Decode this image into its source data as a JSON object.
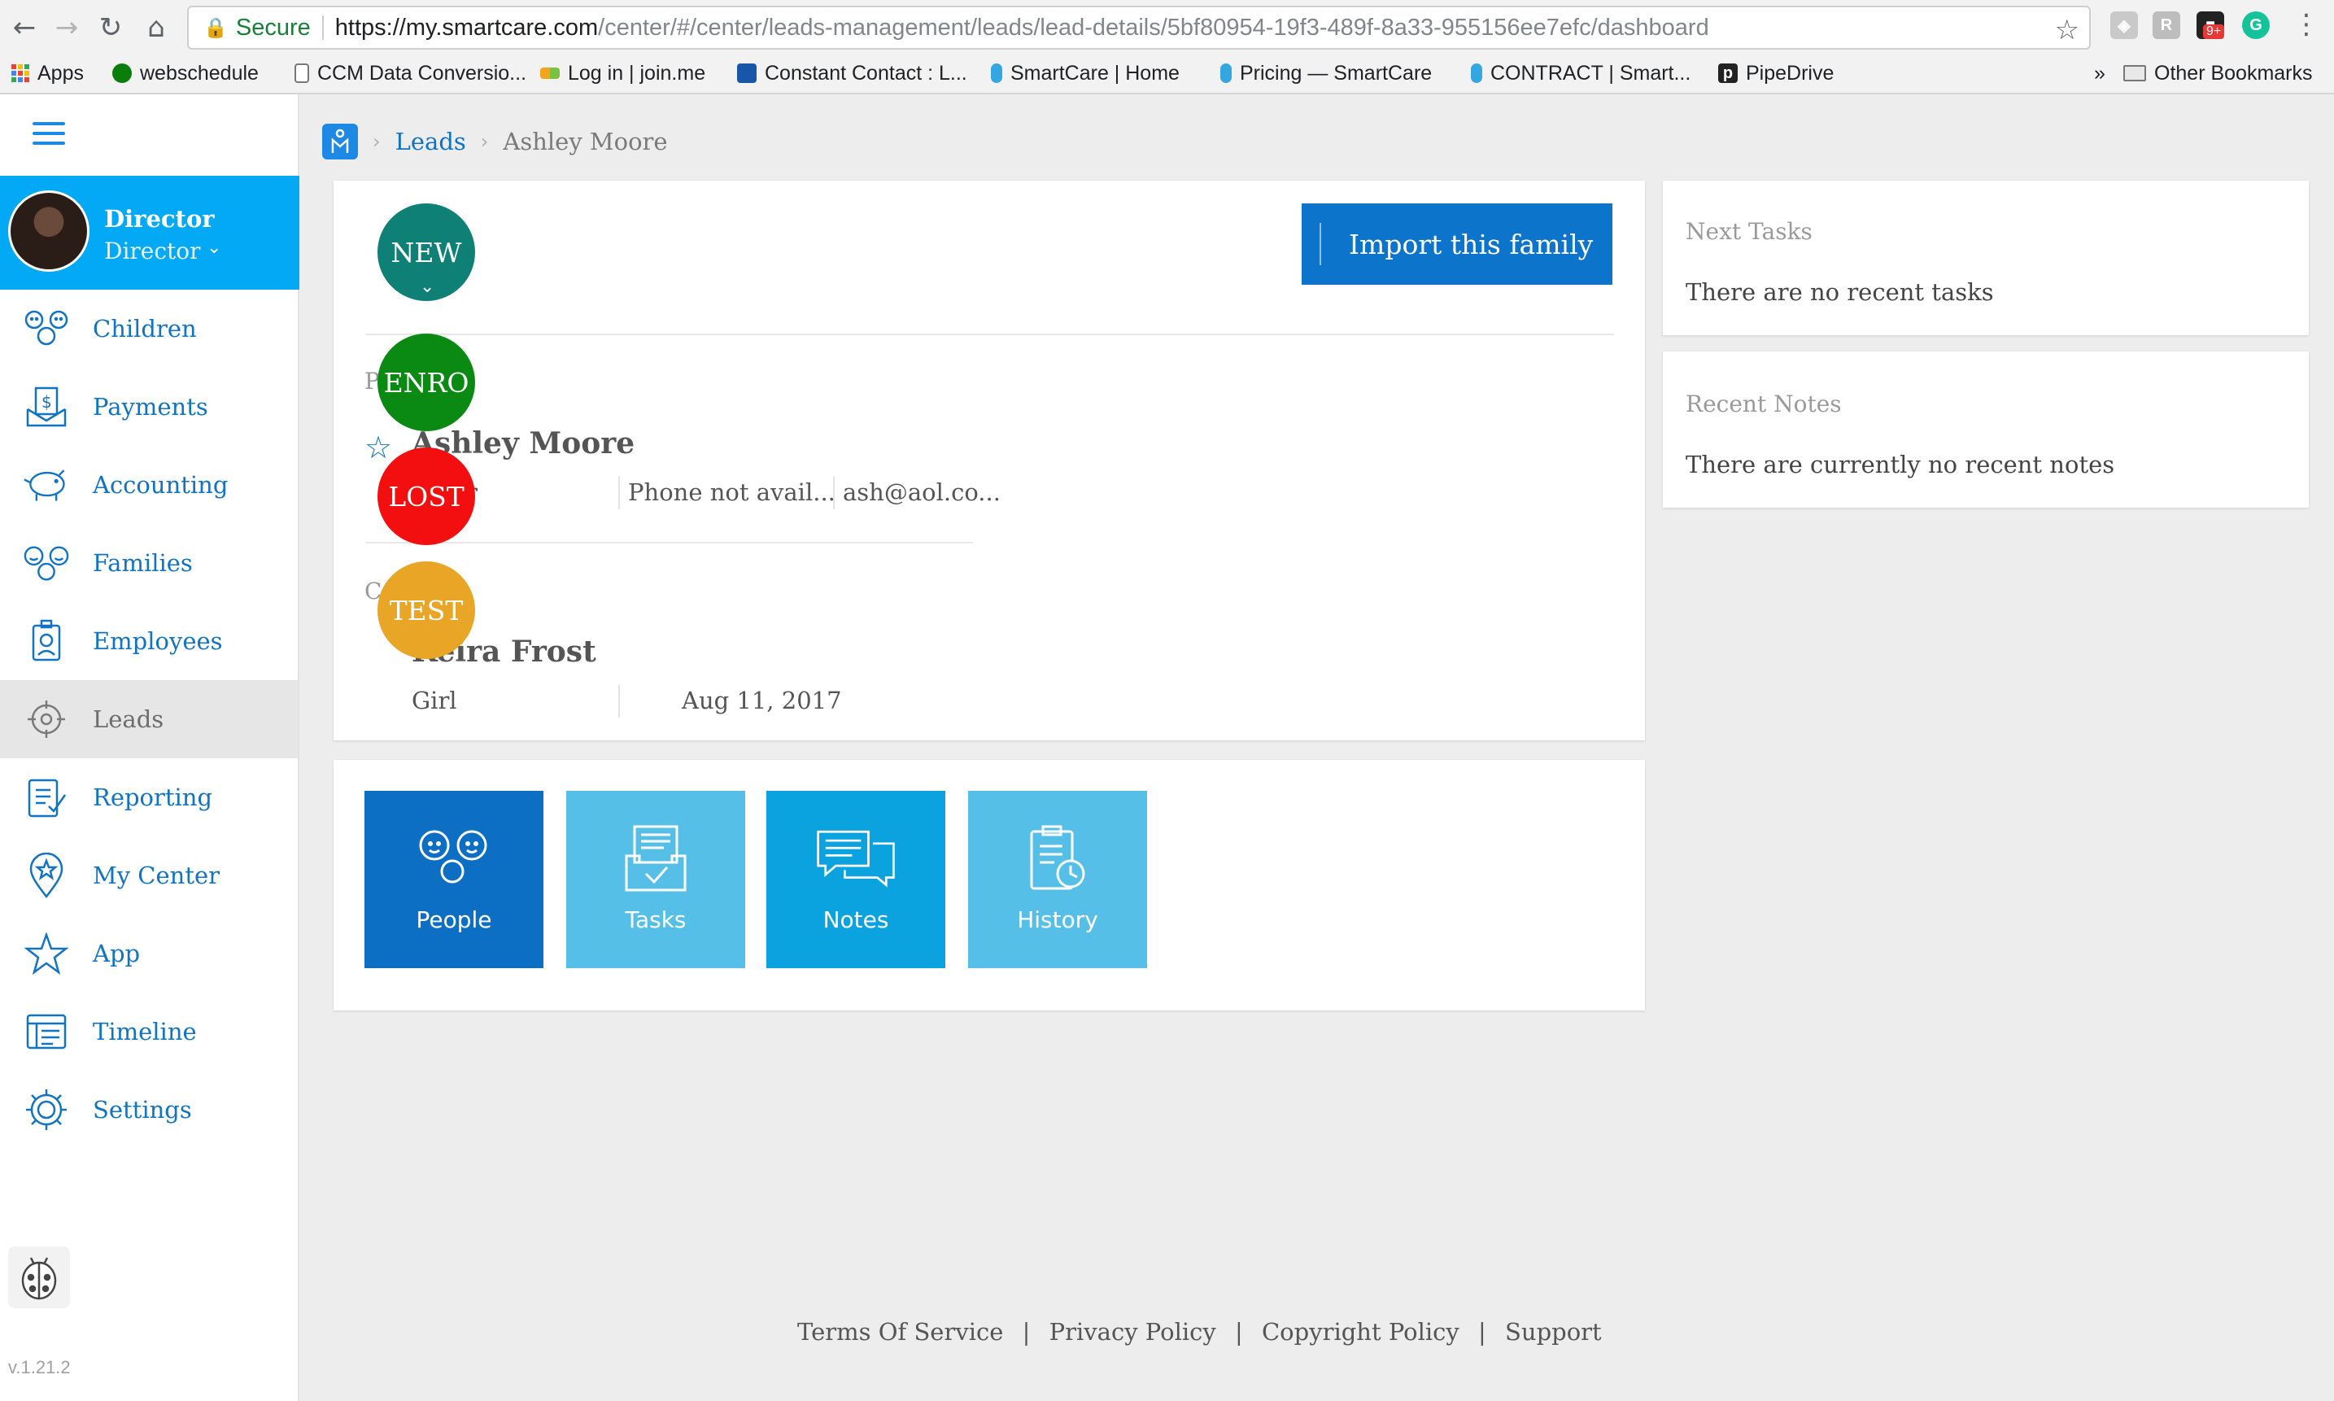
{
  "browser": {
    "secure_label": "Secure",
    "url_host": "https://my.smartcare.com",
    "url_path": "/center/#/center/leads-management/leads/lead-details/5bf80954-19f3-489f-8a33-955156ee7efc/dashboard",
    "extension_badge": "9+",
    "bookmarks": [
      {
        "label": "Apps"
      },
      {
        "label": "webschedule"
      },
      {
        "label": "CCM Data Conversio..."
      },
      {
        "label": "Log in | join.me"
      },
      {
        "label": "Constant Contact : L..."
      },
      {
        "label": "SmartCare | Home"
      },
      {
        "label": "Pricing — SmartCare"
      },
      {
        "label": "CONTRACT | Smart..."
      },
      {
        "label": "PipeDrive"
      }
    ],
    "overflow_label": "»",
    "other_bookmarks": "Other Bookmarks"
  },
  "sidebar": {
    "profile_name": "Director",
    "profile_role": "Director",
    "items": [
      {
        "label": "Children",
        "icon": "children-icon"
      },
      {
        "label": "Payments",
        "icon": "payments-icon"
      },
      {
        "label": "Accounting",
        "icon": "piggy-bank-icon"
      },
      {
        "label": "Families",
        "icon": "families-icon"
      },
      {
        "label": "Employees",
        "icon": "employee-badge-icon"
      },
      {
        "label": "Leads",
        "icon": "target-icon",
        "active": true
      },
      {
        "label": "Reporting",
        "icon": "reporting-icon"
      },
      {
        "label": "My Center",
        "icon": "location-star-icon"
      },
      {
        "label": "App",
        "icon": "star-icon"
      },
      {
        "label": "Timeline",
        "icon": "timeline-icon"
      },
      {
        "label": "Settings",
        "icon": "gear-icon"
      }
    ],
    "version": "v.1.21.2"
  },
  "breadcrumb": {
    "leads": "Leads",
    "current": "Ashley Moore"
  },
  "lead": {
    "import_button": "Import this family",
    "statuses": [
      {
        "label": "NEW",
        "color": "#0e8075"
      },
      {
        "label": "ENRO",
        "color": "#0a8a12"
      },
      {
        "label": "LOST",
        "color": "#f30f0f"
      },
      {
        "label": "TEST",
        "color": "#e8a526"
      }
    ],
    "parent_section_fragment": "P",
    "parent_name": "Ashley Moore",
    "parent_role_fragment": "er",
    "parent_phone": "Phone not avail...",
    "parent_email": "ash@aol.co...",
    "child_section_fragment": "C",
    "child_name": "Keira Frost",
    "child_gender": "Girl",
    "child_dob": "Aug 11, 2017"
  },
  "tiles": [
    {
      "label": "People",
      "icon": "people-icon",
      "color": "#0c6fc3"
    },
    {
      "label": "Tasks",
      "icon": "tasks-icon",
      "color": "#56bfe8"
    },
    {
      "label": "Notes",
      "icon": "notes-icon",
      "color": "#0aa3e0"
    },
    {
      "label": "History",
      "icon": "history-icon",
      "color": "#56bfe8"
    }
  ],
  "panels": {
    "next_tasks_title": "Next Tasks",
    "next_tasks_text": "There are no recent tasks",
    "recent_notes_title": "Recent Notes",
    "recent_notes_text": "There are currently no recent notes"
  },
  "footer": {
    "links": [
      "Terms Of Service",
      "Privacy Policy",
      "Copyright Policy",
      "Support"
    ],
    "separator": "|"
  }
}
